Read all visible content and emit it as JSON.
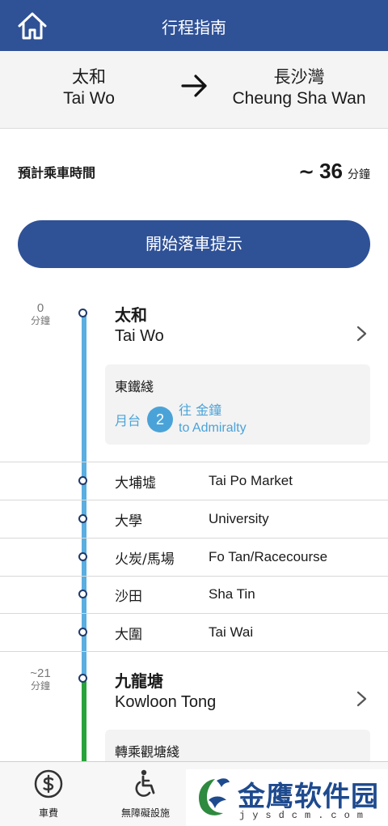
{
  "header": {
    "title": "行程指南",
    "home_icon": "home-icon"
  },
  "route": {
    "from_zh": "太和",
    "from_en": "Tai Wo",
    "to_zh": "長沙灣",
    "to_en": "Cheung Sha Wan",
    "arrow_icon": "arrow-right-icon"
  },
  "ride": {
    "label": "預計乘車時間",
    "tilde": "~",
    "value": "36",
    "unit": "分鐘"
  },
  "start_button": {
    "label": "開始落車提示"
  },
  "timeline": {
    "origin": {
      "time_num": "0",
      "time_unit": "分鐘",
      "name_zh": "太和",
      "name_en": "Tai Wo",
      "line_name": "東鐵綫",
      "platform_label": "月台",
      "platform_num": "2",
      "towards_zh": "往 金鐘",
      "towards_en": "to Admiralty"
    },
    "stops": [
      {
        "zh": "大埔墟",
        "en": "Tai Po Market"
      },
      {
        "zh": "大學",
        "en": "University"
      },
      {
        "zh": "火炭/馬場",
        "en": "Fo Tan/Racecourse"
      },
      {
        "zh": "沙田",
        "en": "Sha Tin"
      },
      {
        "zh": "大圍",
        "en": "Tai Wai"
      }
    ],
    "interchange": {
      "time_num": "~21",
      "time_unit": "分鐘",
      "name_zh": "九龍塘",
      "name_en": "Kowloon Tong",
      "transfer_label": "轉乘觀塘綫"
    },
    "colors": {
      "east_rail": "#5aaee0",
      "kwun_tong": "#27a33a",
      "platform": "#4aa3d8"
    }
  },
  "tabbar": {
    "items": [
      {
        "label": "車費",
        "icon": "fare-dollar-icon"
      },
      {
        "label": "無障礙設施",
        "icon": "wheelchair-icon"
      }
    ]
  },
  "watermark": {
    "text": "金鹰软件园",
    "sub": "jysdcm.com"
  },
  "colors": {
    "brand": "#2f5196",
    "background": "#ffffff",
    "panel": "#f4f4f4"
  }
}
